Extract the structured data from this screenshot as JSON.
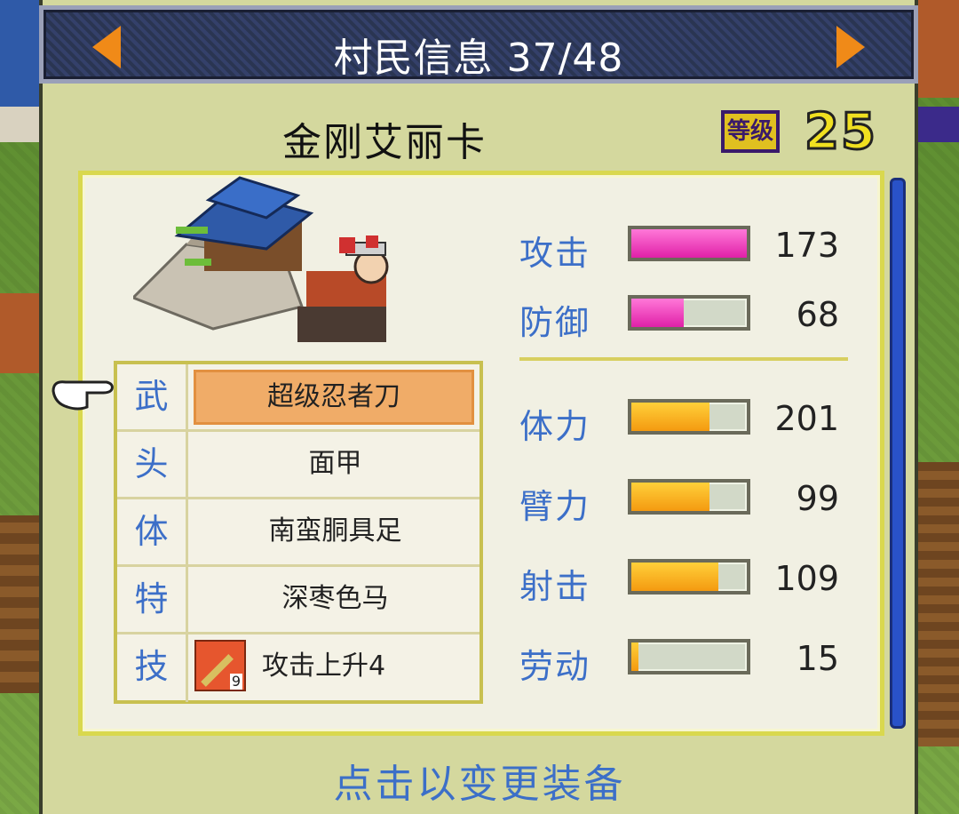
{
  "header": {
    "title": "村民信息 37/48"
  },
  "character": {
    "name": "金刚艾丽卡",
    "level_label": "等级",
    "level": "25"
  },
  "equipment": [
    {
      "slot": "武",
      "item": "超级忍者刀",
      "selected": true
    },
    {
      "slot": "头",
      "item": "面甲"
    },
    {
      "slot": "体",
      "item": "南蛮胴具足"
    },
    {
      "slot": "特",
      "item": "深枣色马"
    },
    {
      "slot": "技",
      "item": "攻击上升4",
      "icon": "sword-skill-icon",
      "icon_badge": "9"
    }
  ],
  "stats": [
    {
      "label": "攻击",
      "value": "173",
      "fill": 1.0,
      "color": "pink"
    },
    {
      "label": "防御",
      "value": "68",
      "fill": 0.45,
      "color": "pink"
    },
    {
      "label": "体力",
      "value": "201",
      "fill": 0.68,
      "color": "orange"
    },
    {
      "label": "臂力",
      "value": "99",
      "fill": 0.68,
      "color": "orange"
    },
    {
      "label": "射击",
      "value": "109",
      "fill": 0.75,
      "color": "orange"
    },
    {
      "label": "劳动",
      "value": "15",
      "fill": 0.06,
      "color": "orange"
    }
  ],
  "footer": {
    "hint": "点击以变更装备"
  },
  "colors": {
    "accent_blue": "#3c6fc8",
    "bar_pink": "#e020a8",
    "bar_orange": "#f49a10",
    "selected_item": "#f0ac68"
  }
}
